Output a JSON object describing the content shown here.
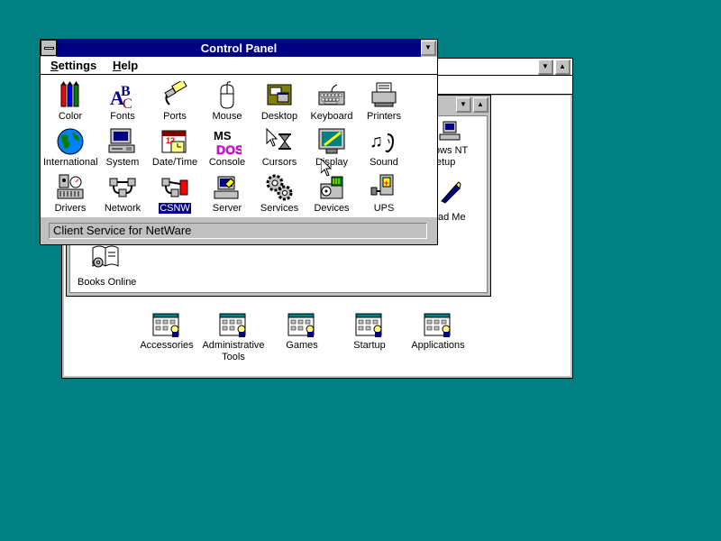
{
  "control_panel": {
    "title": "Control Panel",
    "menu": [
      {
        "label": "Settings",
        "key": "S"
      },
      {
        "label": "Help",
        "key": "H"
      }
    ],
    "icons": [
      {
        "label": "Color",
        "icon": "color-icon"
      },
      {
        "label": "Fonts",
        "icon": "fonts-icon"
      },
      {
        "label": "Ports",
        "icon": "ports-icon"
      },
      {
        "label": "Mouse",
        "icon": "mouse-icon"
      },
      {
        "label": "Desktop",
        "icon": "desktop-icon"
      },
      {
        "label": "Keyboard",
        "icon": "keyboard-icon"
      },
      {
        "label": "Printers",
        "icon": "printer-icon"
      },
      {
        "label": "International",
        "icon": "globe-icon"
      },
      {
        "label": "System",
        "icon": "system-icon"
      },
      {
        "label": "Date/Time",
        "icon": "calendar-clock-icon"
      },
      {
        "label": "Console",
        "icon": "console-icon"
      },
      {
        "label": "Cursors",
        "icon": "cursors-icon"
      },
      {
        "label": "Display",
        "icon": "display-icon"
      },
      {
        "label": "Sound",
        "icon": "sound-icon"
      },
      {
        "label": "Drivers",
        "icon": "drivers-icon"
      },
      {
        "label": "Network",
        "icon": "network-icon"
      },
      {
        "label": "CSNW",
        "icon": "csnw-icon",
        "selected": true
      },
      {
        "label": "Server",
        "icon": "server-icon"
      },
      {
        "label": "Services",
        "icon": "services-icon"
      },
      {
        "label": "Devices",
        "icon": "devices-icon"
      },
      {
        "label": "UPS",
        "icon": "ups-icon"
      }
    ],
    "status": "Client Service for NetWare"
  },
  "main_group": {
    "partial_icons": [
      {
        "lines": [
          "ows NT",
          "etup"
        ],
        "icon": "setup-icon"
      },
      {
        "lines": [
          "ad Me"
        ],
        "icon": "readme-icon"
      }
    ],
    "books_online": "Books Online"
  },
  "program_manager_groups": [
    {
      "label": "Accessories"
    },
    {
      "label": "Administrative Tools"
    },
    {
      "label": "Games"
    },
    {
      "label": "Startup"
    },
    {
      "label": "Applications"
    }
  ],
  "colors": {
    "desktop": "#008080",
    "active_title": "#000080",
    "window_face": "#c0c0c0"
  }
}
